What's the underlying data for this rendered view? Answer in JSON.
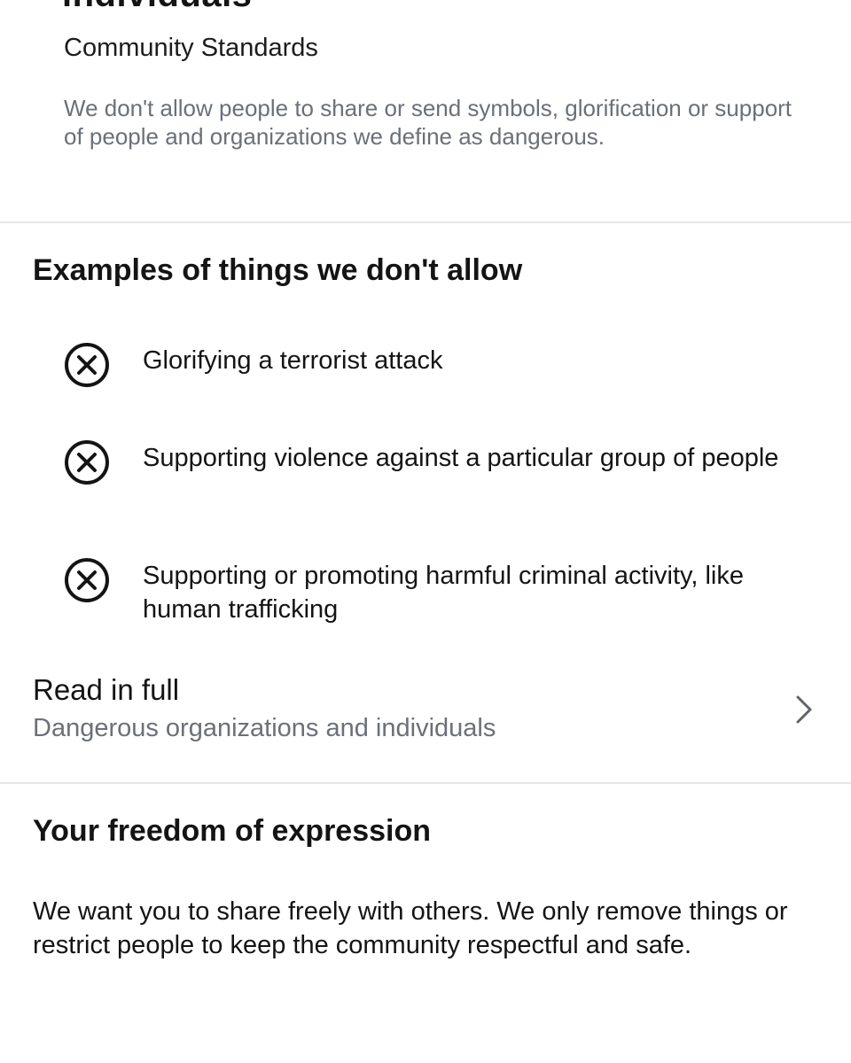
{
  "header": {
    "cut_title": "individuals",
    "subtitle": "Community Standards",
    "description": "We don't allow people to share or send symbols, glorification or support of people and organizations we define as dangerous."
  },
  "examples": {
    "heading": "Examples of things we don't allow",
    "icon": "circle-x-icon",
    "items": [
      "Glorifying a terrorist attack",
      "Supporting violence against a particular group of people",
      "Supporting or promoting harmful criminal activity, like human trafficking"
    ]
  },
  "read_full": {
    "label": "Read in full",
    "sublabel": "Dangerous organizations and individuals",
    "icon": "chevron-right-icon"
  },
  "freedom": {
    "heading": "Your freedom of expression",
    "body": "We want you to share freely with others. We only remove things or restrict people to keep the community respectful and safe."
  },
  "colors": {
    "text": "#141414",
    "secondary_text": "#6b7078",
    "divider": "#e4e6e9",
    "background": "#ffffff"
  }
}
